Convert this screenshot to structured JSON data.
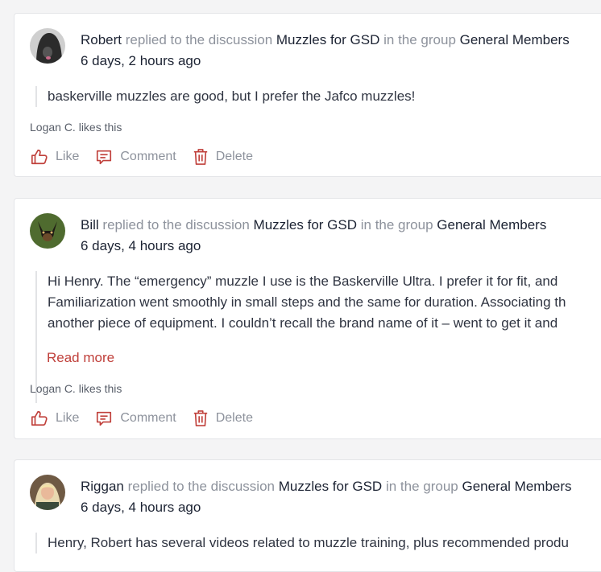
{
  "actions": {
    "like": "Like",
    "comment": "Comment",
    "delete": "Delete"
  },
  "feed": [
    {
      "author": "Robert",
      "verb": "replied to the discussion",
      "discussion": "Muzzles for GSD",
      "group_prefix": "in the group",
      "group": "General Members",
      "time": "6 days, 2 hours ago",
      "lines": [
        "baskerville muzzles are good, but I prefer the Jafco muzzles!"
      ],
      "likes": "Logan C. likes this"
    },
    {
      "author": "Bill",
      "verb": "replied to the discussion",
      "discussion": "Muzzles for GSD",
      "group_prefix": "in the group",
      "group": "General Members",
      "time": "6 days, 4 hours ago",
      "lines": [
        "Hi Henry. The “emergency” muzzle I use is the Baskerville Ultra. I prefer it for fit, and",
        "Familiarization went smoothly in small steps and the same for duration. Associating th",
        "another piece of equipment. I couldn’t recall the brand name of it – went to get it and"
      ],
      "read_more": "Read more",
      "likes": "Logan C. likes this"
    },
    {
      "author": "Riggan",
      "verb": "replied to the discussion",
      "discussion": "Muzzles for GSD",
      "group_prefix": "in the group",
      "group": "General Members",
      "time": "6 days, 4 hours ago",
      "lines": [
        "Henry, Robert has several videos related to muzzle training, plus recommended produ"
      ]
    }
  ],
  "colors": {
    "accent": "#c0403b",
    "muted": "#8d929c",
    "dark": "#1c2333"
  }
}
